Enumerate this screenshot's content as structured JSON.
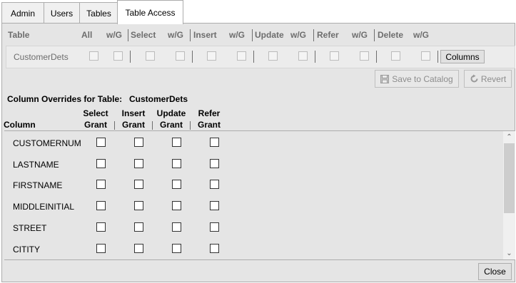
{
  "tabs": [
    {
      "label": "Admin"
    },
    {
      "label": "Users"
    },
    {
      "label": "Tables"
    },
    {
      "label": "Table Access"
    }
  ],
  "grid_header": {
    "table": "Table",
    "all": "All",
    "wg1": "w/G",
    "select": "Select",
    "wg2": "w/G",
    "insert": "Insert",
    "wg3": "w/G",
    "update": "Update",
    "wg4": "w/G",
    "refer": "Refer",
    "wg5": "w/G",
    "delete": "Delete",
    "wg6": "w/G"
  },
  "table_row": {
    "name": "CustomerDets",
    "columns_button": "Columns"
  },
  "actions": {
    "save": "Save to Catalog",
    "revert": "Revert"
  },
  "overrides": {
    "title": "Column Overrides for Table:",
    "table": "CustomerDets",
    "column_header": "Column",
    "headers": [
      {
        "l1": "Select",
        "l2": "Grant"
      },
      {
        "l1": "Insert",
        "l2": "Grant"
      },
      {
        "l1": "Update",
        "l2": "Grant"
      },
      {
        "l1": "Refer",
        "l2": "Grant"
      }
    ],
    "rows": [
      {
        "name": "CUSTOMERNUM"
      },
      {
        "name": "LASTNAME"
      },
      {
        "name": "FIRSTNAME"
      },
      {
        "name": "MIDDLEINITIAL"
      },
      {
        "name": "STREET"
      },
      {
        "name": "CITITY"
      }
    ]
  },
  "footer": {
    "close": "Close"
  }
}
